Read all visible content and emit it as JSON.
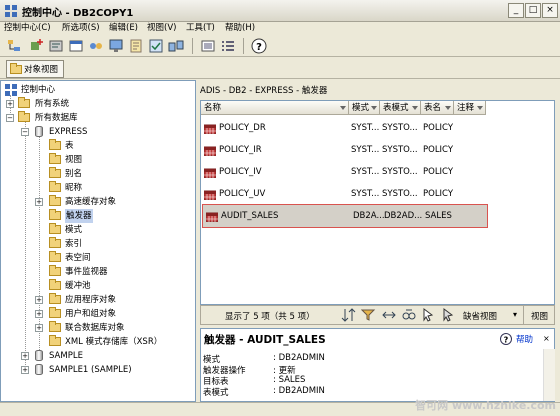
{
  "window": {
    "title": "控制中心 - DB2COPY1",
    "minimize": "_",
    "maximize": "□",
    "close": "×"
  },
  "menu": [
    "控制中心(C)",
    "所选项(S)",
    "编辑(E)",
    "视图(V)",
    "工具(T)",
    "帮助(H)"
  ],
  "objectview": {
    "label": "对象视图"
  },
  "tree": {
    "root": "控制中心",
    "all_systems": "所有系统",
    "all_databases": "所有数据库",
    "express": "EXPRESS",
    "children": [
      "表",
      "视图",
      "别名",
      "昵称",
      "高速缓存对象",
      "触发器",
      "模式",
      "索引",
      "表空间",
      "事件监视器",
      "缓冲池",
      "应用程序对象",
      "用户和组对象",
      "联合数据库对象",
      "XML 模式存储库（XSR）"
    ],
    "sample": "SAMPLE",
    "sample1": "SAMPLE1 (SAMPLE)",
    "selected": "触发器"
  },
  "breadcrumb": "ADIS - DB2 - EXPRESS - 触发器",
  "table": {
    "columns": [
      "名称",
      "模式",
      "表模式",
      "表名",
      "注释"
    ],
    "rows": [
      [
        "POLICY_DR",
        "SYST...",
        "SYSTO...",
        "POLICY",
        ""
      ],
      [
        "POLICY_IR",
        "SYST...",
        "SYSTO...",
        "POLICY",
        ""
      ],
      [
        "POLICY_IV",
        "SYST...",
        "SYSTO...",
        "POLICY",
        ""
      ],
      [
        "POLICY_UV",
        "SYST...",
        "SYSTO...",
        "POLICY",
        ""
      ],
      [
        "AUDIT_SALES",
        "DB2A...",
        "DB2AD...",
        "SALES",
        ""
      ]
    ],
    "selected_row": 4
  },
  "footer": {
    "count": "显示了 5 项（共 5 项）",
    "default_view": "缺省视图",
    "view": "视图"
  },
  "detail": {
    "title": "触发器 - AUDIT_SALES",
    "help": "帮助",
    "fields": [
      {
        "label": "模式",
        "value": ": DB2ADMIN"
      },
      {
        "label": "触发器操作",
        "value": ": 更新"
      },
      {
        "label": "目标表",
        "value": ": SALES"
      },
      {
        "label": "表模式",
        "value": ": DB2ADMIN"
      }
    ]
  },
  "watermark": "智可网 www.hzhike.com",
  "colors": {
    "selection": "#c1d2ee",
    "highlight_border": "#d9534f",
    "panel_border": "#7f9db9"
  }
}
